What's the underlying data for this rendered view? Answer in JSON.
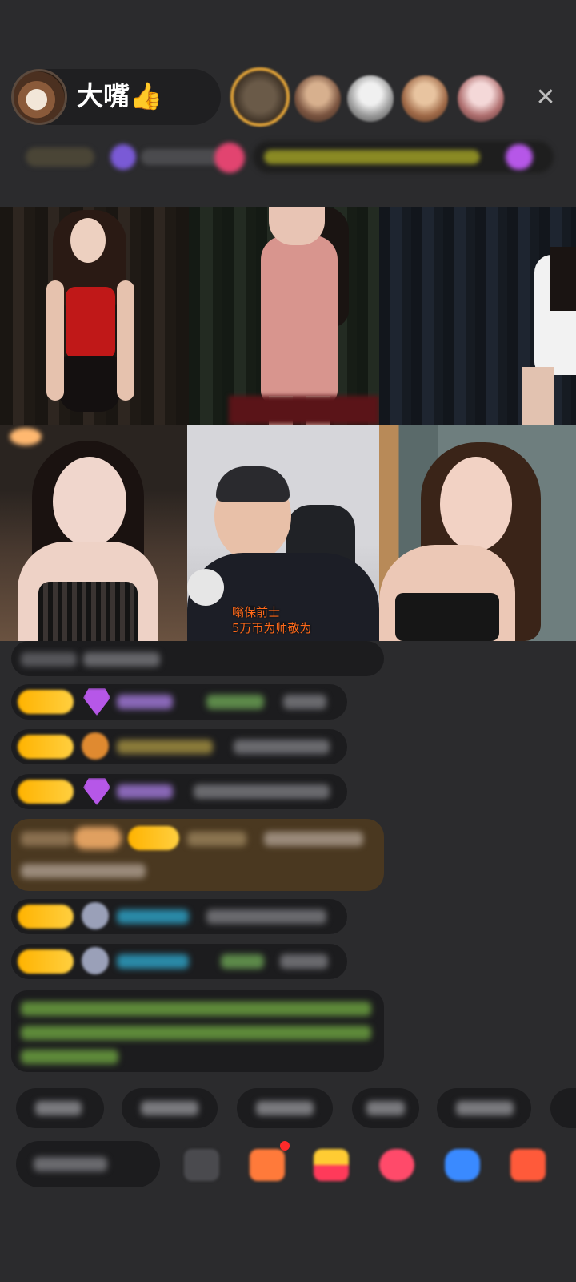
{
  "header": {
    "host_name": "大嘴👍",
    "close_glyph": "✕"
  },
  "video": {
    "caption_line1": "嗡保前士",
    "caption_line2": "5万币为师敬为"
  },
  "colors": {
    "background": "#2b2b2d",
    "pill": "#1c1c1e",
    "badge": "#ffb300",
    "caption": "#ff6a1a",
    "chat_green": "#8bc34a",
    "chat_cyan": "#29b6d6",
    "chat_purple": "#b657e8"
  },
  "icons": [
    "avatar",
    "close-icon",
    "gem-icon",
    "gift-icon",
    "chat-icon",
    "share-icon"
  ]
}
